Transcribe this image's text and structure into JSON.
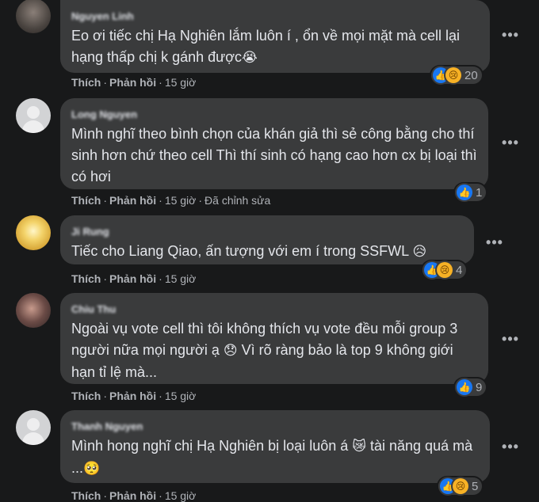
{
  "comments": [
    {
      "author": "Nguyen Linh",
      "text": "Eo ơi tiếc chị Hạ Nghiên lắm luôn í , ổn về mọi mặt mà cell lại hạng thấp chị k gánh được",
      "emoji": "😭",
      "actions": {
        "like": "Thích",
        "reply": "Phản hồi",
        "time": "15 giờ",
        "edited": ""
      },
      "reactions": {
        "icons": [
          "like-icon",
          "sad-icon"
        ],
        "count": "20"
      }
    },
    {
      "author": "Long Nguyen",
      "text": "Mình nghĩ theo bình chọn của khán giả thì sẻ công bằng cho thí sinh hơn chứ theo cell Thì thí sinh có hạng cao hơn cx bị loại thì có hơi",
      "emoji": "",
      "actions": {
        "like": "Thích",
        "reply": "Phản hồi",
        "time": "15 giờ",
        "edited": "Đã chỉnh sửa"
      },
      "reactions": {
        "icons": [
          "like-icon"
        ],
        "count": "1"
      }
    },
    {
      "author": "Ji Rung",
      "text": "Tiếc cho Liang Qiao, ấn tượng với em í trong SSFWL",
      "emoji": "😥",
      "actions": {
        "like": "Thích",
        "reply": "Phản hồi",
        "time": "15 giờ",
        "edited": ""
      },
      "reactions": {
        "icons": [
          "like-icon",
          "sad-icon"
        ],
        "count": "4"
      }
    },
    {
      "author": "Chiu Thu",
      "text_before": "Ngoài vụ vote cell thì tôi không thích vụ vote đều mỗi group 3 người nữa mọi người ạ",
      "emoji": "😞",
      "text_after": "Vì rõ ràng bảo là top 9 không giới hạn tỉ lệ mà...",
      "actions": {
        "like": "Thích",
        "reply": "Phản hồi",
        "time": "15 giờ",
        "edited": ""
      },
      "reactions": {
        "icons": [
          "like-icon"
        ],
        "count": "9"
      }
    },
    {
      "author": "Thanh Nguyen",
      "text_before": "Mình hong nghĩ chị Hạ Nghiên bị loại luôn á",
      "emoji": "😿",
      "text_mid": "tài năng quá mà ...",
      "emoji2": "🥺",
      "actions": {
        "like": "Thích",
        "reply": "Phản hồi",
        "time": "15 giờ",
        "edited": ""
      },
      "reactions": {
        "icons": [
          "like-icon",
          "sad-icon"
        ],
        "count": "5"
      }
    }
  ],
  "colors": {
    "background": "#18191a",
    "bubble": "#3a3b3c",
    "text": "#e4e6eb",
    "muted": "#b0b3b8",
    "like": "#1877f2",
    "sad": "#f7b125"
  }
}
